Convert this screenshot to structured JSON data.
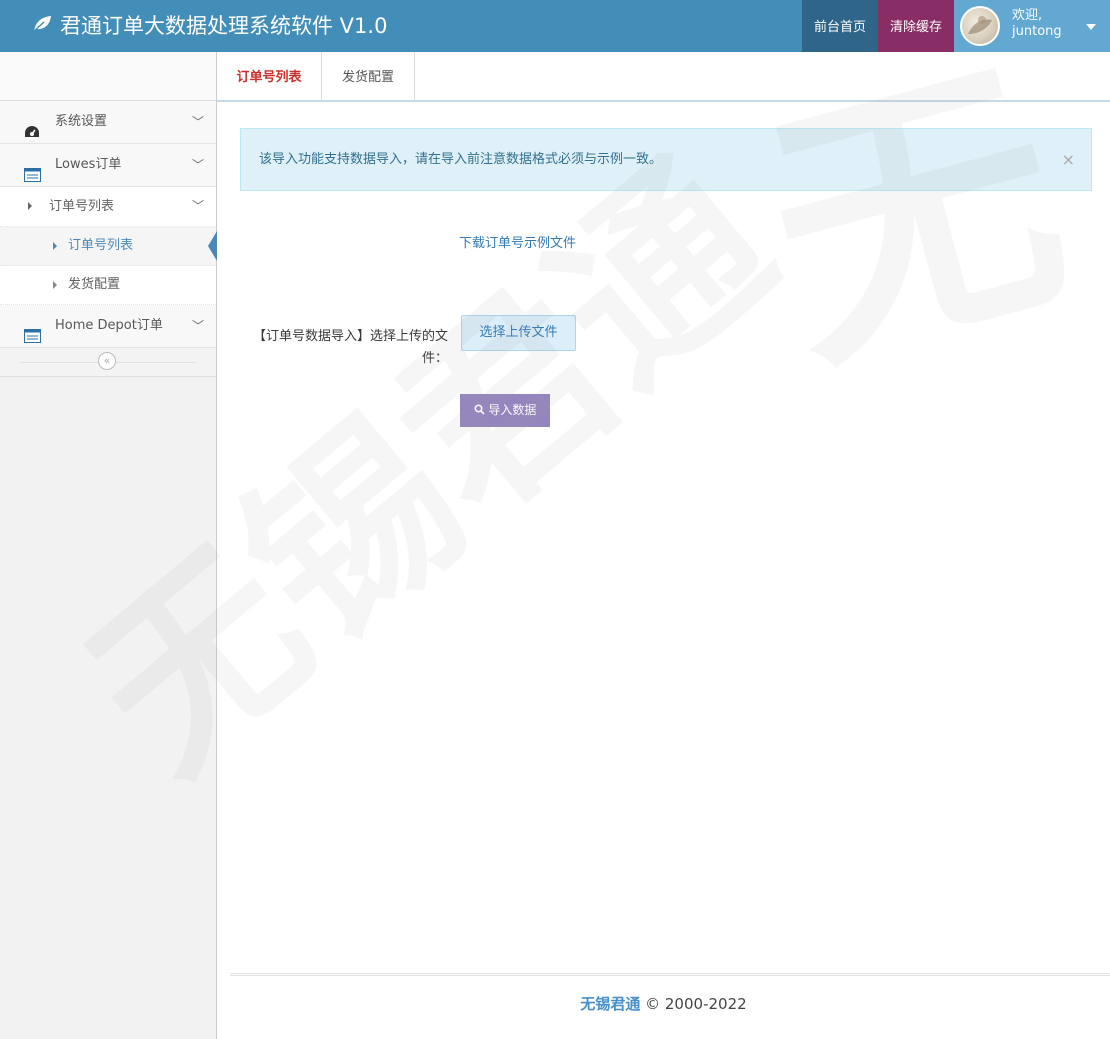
{
  "navbar": {
    "brand_title": "君通订单大数据处理系统软件 V1.0",
    "front_page": "前台首页",
    "clear_cache": "清除缓存",
    "welcome": "欢迎,",
    "username": "juntong"
  },
  "sidebar": {
    "items": [
      {
        "label": "系统设置"
      },
      {
        "label": "Lowes订单"
      },
      {
        "label": "订单号列表"
      },
      {
        "label": "订单号列表"
      },
      {
        "label": "发货配置"
      },
      {
        "label": "Home Depot订单"
      }
    ],
    "collapse_glyph": "«"
  },
  "tabs": [
    {
      "label": "订单号列表"
    },
    {
      "label": "发货配置"
    }
  ],
  "alert": {
    "text": "该导入功能支持数据导入，请在导入前注意数据格式必须与示例一致。",
    "close": "×"
  },
  "form": {
    "download_link": "下载订单号示例文件",
    "label": "【订单号数据导入】选择上传的文件：",
    "upload_button": "选择上传文件",
    "import_button": "导入数据"
  },
  "footer": {
    "brand": "无锡君通",
    "copyright": "© 2000-2022"
  },
  "watermark": {
    "big_char": "无",
    "text1": "无锡君通"
  },
  "colors": {
    "navbar": "#438eb9",
    "front_btn": "#2e6589",
    "clear_btn": "#892e65",
    "user_btn": "#62a8d1",
    "active_tab": "#c9302c",
    "import_btn": "#9585bf"
  }
}
